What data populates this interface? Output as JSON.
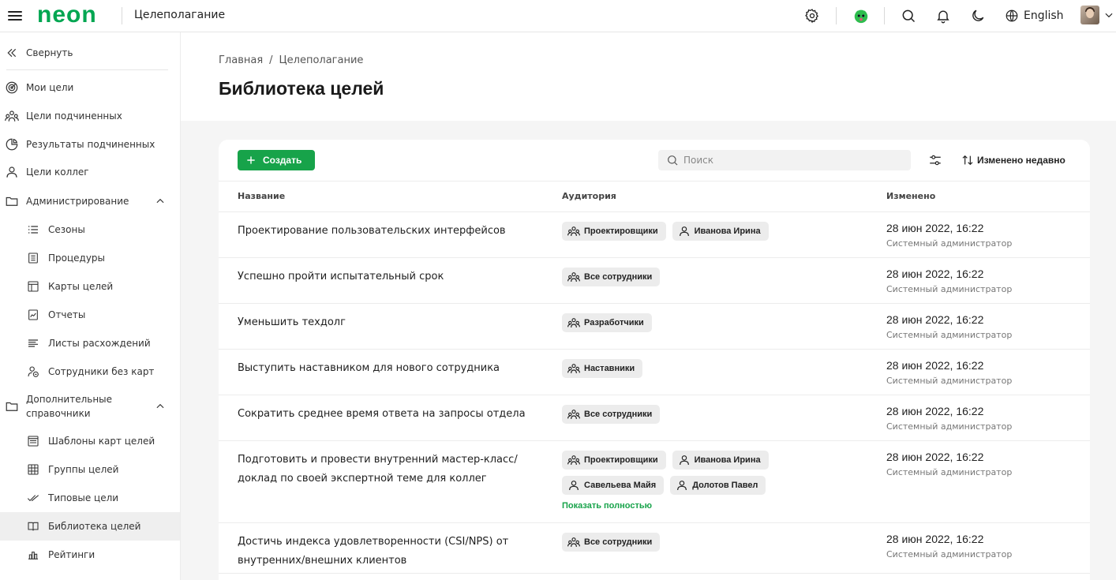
{
  "app": {
    "logo": "neon",
    "title": "Целеполагание",
    "language": "English"
  },
  "sidebar": {
    "collapse": "Свернуть",
    "items": [
      {
        "label": "Мои цели",
        "icon": "target-icon"
      },
      {
        "label": "Цели подчиненных",
        "icon": "users-icon"
      },
      {
        "label": "Результаты подчиненных",
        "icon": "pie-chart-icon"
      },
      {
        "label": "Цели коллег",
        "icon": "user-icon"
      },
      {
        "label": "Администрирование",
        "icon": "folder-icon",
        "expanded": true
      }
    ],
    "admin_items": [
      {
        "label": "Сезоны",
        "icon": "list-icon"
      },
      {
        "label": "Процедуры",
        "icon": "document-list-icon"
      },
      {
        "label": "Карты целей",
        "icon": "layout-icon"
      },
      {
        "label": "Отчеты",
        "icon": "report-icon"
      },
      {
        "label": "Листы расхождений",
        "icon": "lines-icon"
      },
      {
        "label": "Сотрудники без карт",
        "icon": "user-minus-icon"
      }
    ],
    "extra_group": {
      "label_line1": "Дополнительные",
      "label_line2": "справочники",
      "icon": "folder-icon",
      "expanded": true
    },
    "extra_items": [
      {
        "label": "Шаблоны карт целей",
        "icon": "template-icon"
      },
      {
        "label": "Группы целей",
        "icon": "grid-icon"
      },
      {
        "label": "Типовые цели",
        "icon": "check-double-icon"
      },
      {
        "label": "Библиотека целей",
        "icon": "book-icon",
        "active": true
      },
      {
        "label": "Рейтинги",
        "icon": "rating-icon"
      }
    ]
  },
  "breadcrumb": {
    "home": "Главная",
    "separator": "/",
    "current": "Целеполагание"
  },
  "page": {
    "title": "Библиотека целей"
  },
  "toolbar": {
    "create_label": "Создать",
    "search_placeholder": "Поиск",
    "sort_label": "Изменено недавно"
  },
  "table": {
    "columns": [
      "Название",
      "Аудитория",
      "Изменено"
    ],
    "show_full_label": "Показать полностью",
    "rows": [
      {
        "name": "Проектирование пользовательских интерфейсов",
        "audience": [
          {
            "type": "group",
            "label": "Проектировщики"
          },
          {
            "type": "person",
            "label": "Иванова Ирина"
          }
        ],
        "date": "28 июн 2022, 16:22",
        "author": "Системный администратор"
      },
      {
        "name": "Успешно пройти испытательный срок",
        "audience": [
          {
            "type": "group",
            "label": "Все сотрудники"
          }
        ],
        "date": "28 июн 2022, 16:22",
        "author": "Системный администратор"
      },
      {
        "name": "Уменьшить техдолг",
        "audience": [
          {
            "type": "group",
            "label": "Разработчики"
          }
        ],
        "date": "28 июн 2022, 16:22",
        "author": "Системный администратор"
      },
      {
        "name": "Выступить наставником для нового сотрудника",
        "audience": [
          {
            "type": "group",
            "label": "Наставники"
          }
        ],
        "date": "28 июн 2022, 16:22",
        "author": "Системный администратор"
      },
      {
        "name": "Сократить среднее время ответа на запросы отдела",
        "audience": [
          {
            "type": "group",
            "label": "Все сотрудники"
          }
        ],
        "date": "28 июн 2022, 16:22",
        "author": "Системный администратор"
      },
      {
        "name": "Подготовить и провести внутренний мастер-класс/ доклад по своей экспертной теме для коллег",
        "audience": [
          {
            "type": "group",
            "label": "Проектировщики"
          },
          {
            "type": "person",
            "label": "Иванова Ирина"
          },
          {
            "type": "person",
            "label": "Савельева Майя"
          },
          {
            "type": "person",
            "label": "Долотов Павел"
          }
        ],
        "show_full": true,
        "date": "28 июн 2022, 16:22",
        "author": "Системный администратор"
      },
      {
        "name": "Достичь индекса удовлетворенности (CSI/NPS) от внутренних/внешних клиентов",
        "audience": [
          {
            "type": "group",
            "label": "Все сотрудники"
          }
        ],
        "date": "28 июн 2022, 16:22",
        "author": "Системный администратор"
      }
    ]
  },
  "colors": {
    "brand": "#00a651",
    "button": "#17a34a",
    "chip": "#ececec"
  }
}
